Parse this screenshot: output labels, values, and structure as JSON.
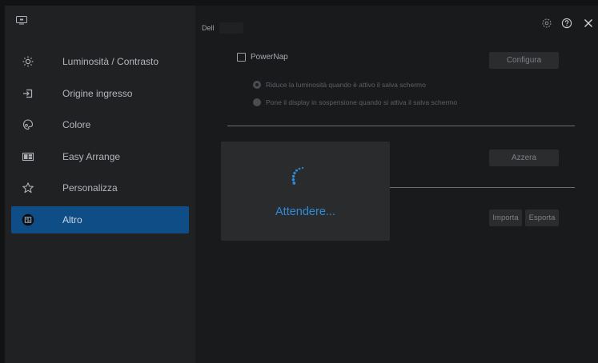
{
  "sidebar": {
    "items": [
      {
        "label": "Luminosità / Contrasto",
        "icon": "brightness-icon"
      },
      {
        "label": "Origine ingresso",
        "icon": "input-source-icon"
      },
      {
        "label": "Colore",
        "icon": "color-icon"
      },
      {
        "label": "Easy Arrange",
        "icon": "easy-arrange-icon"
      },
      {
        "label": "Personalizza",
        "icon": "star-icon"
      },
      {
        "label": "Altro",
        "icon": "other-icon",
        "active": true
      }
    ]
  },
  "header": {
    "monitor_name": "Dell",
    "icons": [
      "settings-icon",
      "help-icon",
      "close-icon"
    ]
  },
  "powernap": {
    "checkbox_label": "PowerNap",
    "checked": false,
    "configure_label": "Configura",
    "options": [
      {
        "label": "Riduce la luminosità quando è attivo il salva schermo",
        "selected": true
      },
      {
        "label": "Pone il display in sospensione quando si attiva il salva schermo",
        "selected": false
      }
    ]
  },
  "reset": {
    "button_label": "Azzera"
  },
  "settings_io": {
    "import_label": "Importa",
    "export_label": "Esporta"
  },
  "overlay": {
    "text": "Attendere..."
  },
  "colors": {
    "accent": "#0f4d86",
    "spinner": "#2f8bd9",
    "background": "#181a1b"
  }
}
